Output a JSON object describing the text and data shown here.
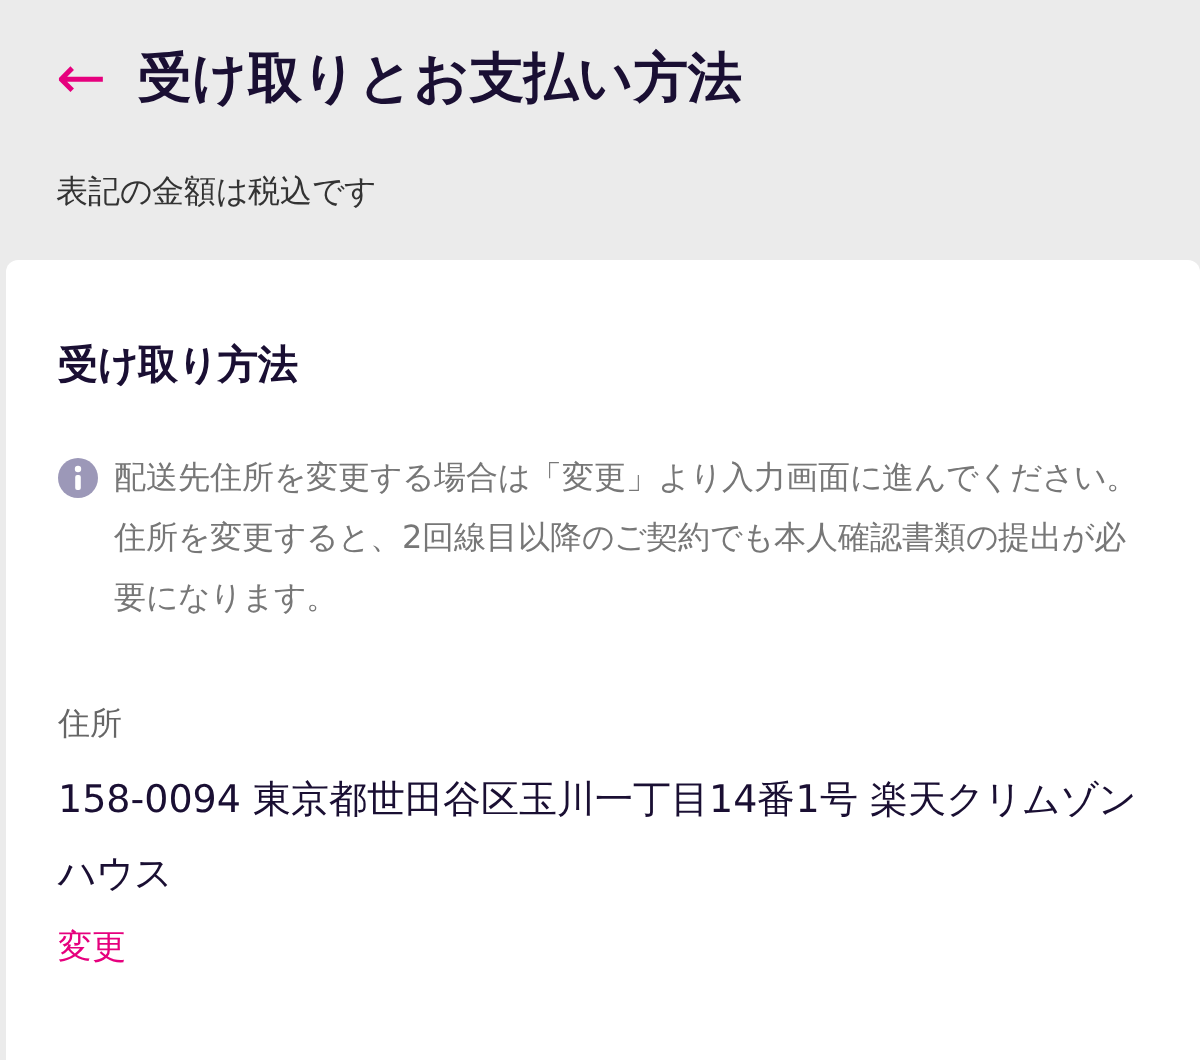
{
  "header": {
    "back_label": "←",
    "title": "受け取りとお支払い方法",
    "subtitle": "表記の金額は税込です"
  },
  "section": {
    "title": "受け取り方法",
    "notice": "配送先住所を変更する場合は「変更」より入力画面に進んでください。住所を変更すると、2回線目以降のご契約でも本人確認書類の提出が必要になります。",
    "address_label": "住所",
    "address": "158-0094 東京都世田谷区玉川一丁目14番1号 楽天クリムゾンハウス",
    "change_link": "変更"
  }
}
